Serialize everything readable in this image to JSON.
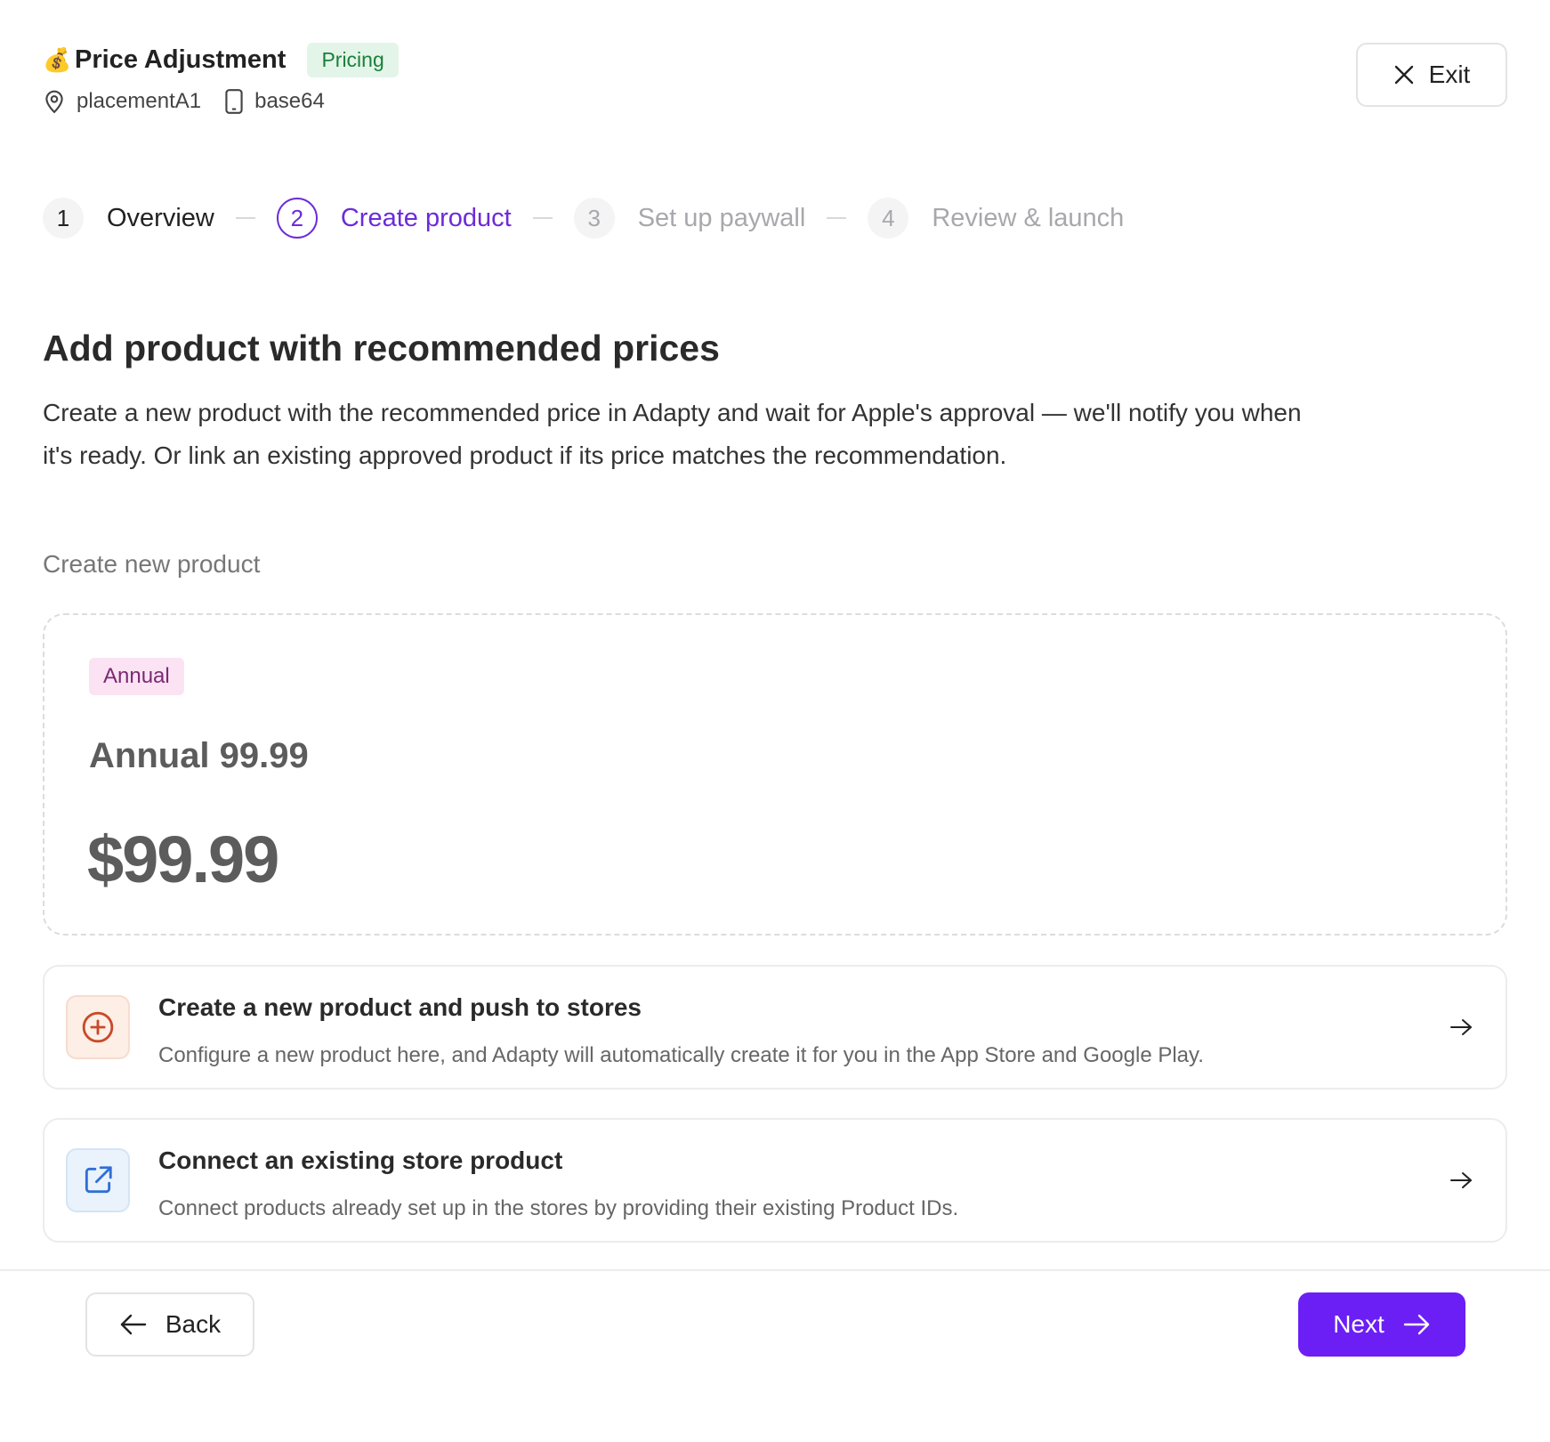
{
  "header": {
    "title": "Price Adjustment",
    "icon": "money-bag-icon",
    "badge": "Pricing",
    "placement": "placementA1",
    "device": "base64",
    "exit_label": "Exit"
  },
  "stepper": {
    "steps": [
      {
        "number": "1",
        "label": "Overview",
        "state": "done"
      },
      {
        "number": "2",
        "label": "Create product",
        "state": "active"
      },
      {
        "number": "3",
        "label": "Set up paywall",
        "state": "pending"
      },
      {
        "number": "4",
        "label": "Review & launch",
        "state": "pending"
      }
    ]
  },
  "main": {
    "title": "Add product with recommended prices",
    "description": "Create a new product with the recommended price in Adapty and wait for Apple's approval — we'll notify you when it's ready. Or link an existing approved product if its price matches the recommendation.",
    "section_label": "Create new product",
    "product": {
      "tag": "Annual",
      "name": "Annual 99.99",
      "price": "$99.99"
    },
    "options": [
      {
        "title": "Create a new product and push to stores",
        "description": "Configure a new product here, and Adapty will automatically create it for you in the App Store and Google Play.",
        "icon": "plus-circle-icon"
      },
      {
        "title": "Connect an existing store product",
        "description": "Connect products already set up in the stores by providing their existing Product IDs.",
        "icon": "external-link-icon"
      }
    ]
  },
  "footer": {
    "back_label": "Back",
    "next_label": "Next"
  },
  "colors": {
    "accent": "#6b1ff5",
    "active_step": "#6c2bd9",
    "pricing_badge_bg": "#e3f5e8",
    "annual_tag_bg": "#fbe3f4"
  }
}
